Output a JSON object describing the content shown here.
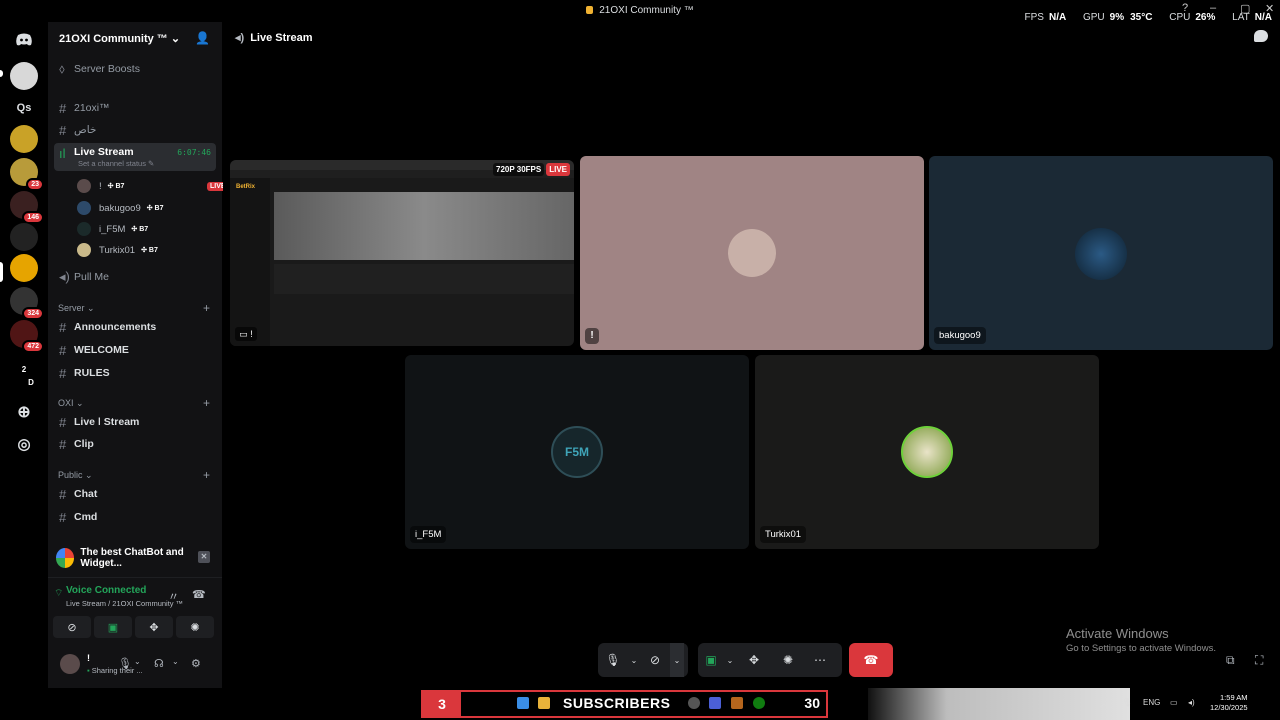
{
  "window": {
    "title": "21OXI Community ™",
    "stats": {
      "fps_label": "FPS",
      "fps": "N/A",
      "gpu_label": "GPU",
      "gpu": "9%",
      "gpu_temp": "35°C",
      "cpu_label": "CPU",
      "cpu": "26%",
      "lat_label": "LAT",
      "lat": "N/A"
    }
  },
  "rail": {
    "home_label": "Qs",
    "badges": [
      "23",
      "146",
      "324",
      "472"
    ],
    "folder_nums": [
      "2",
      "D"
    ]
  },
  "guild": {
    "name": "21OXI Community ™"
  },
  "channels": {
    "boosts": "Server Boosts",
    "c1": "21oxi™",
    "c2": "خاص",
    "live": {
      "name": "Live Stream",
      "time": "6:07:46",
      "status": "Set a channel status"
    },
    "voice_users": [
      {
        "name": "!",
        "tag": "B7",
        "live": "LIVE"
      },
      {
        "name": "bakugoo9",
        "tag": "B7"
      },
      {
        "name": "i_F5M",
        "tag": "B7"
      },
      {
        "name": "Turkix01",
        "tag": "B7"
      }
    ],
    "pull": "Pull Me",
    "cat_server": "Server",
    "server_items": [
      "Announcements",
      "WELCOME",
      "RULES"
    ],
    "cat_oxi": "OXI",
    "oxi_items": [
      "Live ǀ Stream",
      "Clip"
    ],
    "cat_public": "Public",
    "public_items": [
      "Chat",
      "Cmd"
    ]
  },
  "promo": {
    "text": "The best ChatBot and Widget..."
  },
  "voice_panel": {
    "status": "Voice Connected",
    "location": "Live Stream / 21OXI Community ™"
  },
  "user": {
    "name": "!",
    "status": "Sharing their ..."
  },
  "stage": {
    "title": "Live Stream",
    "screen": {
      "quality": "720P 30FPS",
      "live": "LIVE",
      "site_name": "BetRix",
      "warn": "!"
    },
    "tiles": [
      {
        "name": "!"
      },
      {
        "name": "bakugoo9"
      },
      {
        "name": "i_F5M",
        "avatar_text": "F5M"
      },
      {
        "name": "Turkix01"
      }
    ]
  },
  "watermark": {
    "line1": "Activate Windows",
    "line2": "Go to Settings to activate Windows."
  },
  "taskbar": {
    "sub_count": "3",
    "sub_label": "SUBSCRIBERS",
    "sub_goal": "30",
    "lang": "ENG",
    "time": "1:59 AM",
    "date": "12/30/2025"
  },
  "colors": {
    "accent_green": "#23a55a",
    "danger": "#da373c",
    "sidebar_bg": "#121214"
  }
}
